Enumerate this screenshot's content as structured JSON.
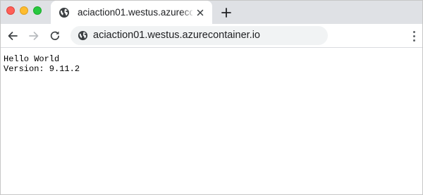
{
  "window_controls": {
    "close": "close",
    "minimize": "minimize",
    "maximize": "maximize"
  },
  "tab": {
    "title": "aciaction01.westus.azurecontainer.io",
    "icon": "globe-icon",
    "close_icon": "close-icon"
  },
  "new_tab": {
    "icon": "plus-icon"
  },
  "toolbar": {
    "back_icon": "back-arrow-icon",
    "forward_icon": "forward-arrow-icon",
    "reload_icon": "reload-icon",
    "menu_icon": "more-vertical-icon"
  },
  "address_bar": {
    "icon": "globe-icon",
    "url": "aciaction01.westus.azurecontainer.io"
  },
  "page": {
    "lines": [
      "Hello World",
      "Version: 9.11.2"
    ]
  },
  "colors": {
    "tabstrip_bg": "#dfe1e5",
    "omnibox_bg": "#f1f3f4",
    "traffic_close": "#ff5f57",
    "traffic_minimize": "#febc2e",
    "traffic_maximize": "#28c840"
  }
}
